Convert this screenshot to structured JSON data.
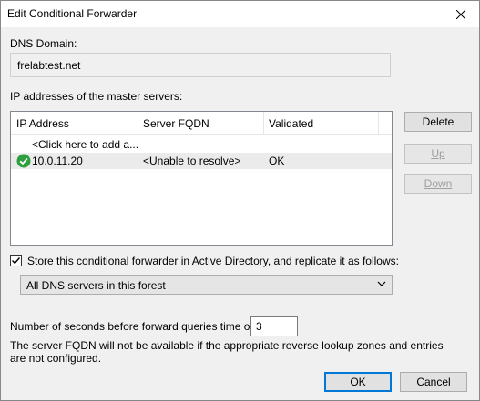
{
  "window": {
    "title": "Edit Conditional Forwarder",
    "close_glyph": "✕"
  },
  "dns_domain": {
    "label": "DNS Domain:",
    "value": "frelabtest.net"
  },
  "master_servers": {
    "label": "IP addresses of the master servers:",
    "columns": [
      "IP Address",
      "Server FQDN",
      "Validated"
    ],
    "add_row_text": "<Click here to add a...",
    "rows": [
      {
        "ip": "10.0.11.20",
        "fqdn": "<Unable to resolve>",
        "validated": "OK",
        "status_icon": "check-circle-icon"
      }
    ]
  },
  "buttons": {
    "delete": "Delete",
    "up": "Up",
    "down": "Down",
    "ok": "OK",
    "cancel": "Cancel"
  },
  "store_ad": {
    "checked": true,
    "label": "Store this conditional forwarder in Active Directory, and replicate it as follows:",
    "replication_selected": "All DNS servers in this forest"
  },
  "timeout": {
    "label": "Number of seconds before forward queries time out:",
    "value": "3"
  },
  "note": "The server FQDN will not be available if the appropriate reverse lookup zones and entries are not configured.",
  "colors": {
    "accent": "#0078d7",
    "ok_green": "#2e9e3e"
  }
}
